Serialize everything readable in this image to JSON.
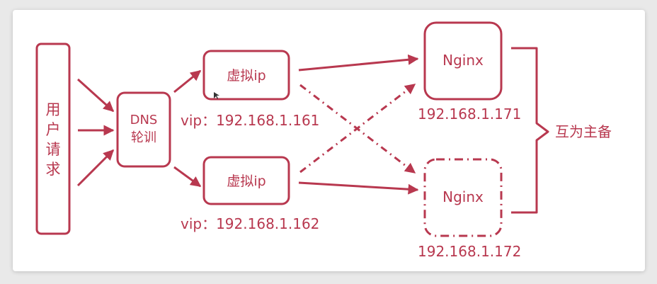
{
  "user_request": {
    "chars": [
      "用",
      "户",
      "请",
      "求"
    ]
  },
  "dns": {
    "line1": "DNS",
    "line2": "轮训"
  },
  "vip_top": {
    "label": "虚拟ip",
    "address": "vip：192.168.1.161"
  },
  "vip_bottom": {
    "label": "虚拟ip",
    "address": "vip：192.168.1.162"
  },
  "nginx_top": {
    "label": "Nginx",
    "address": "192.168.1.171"
  },
  "nginx_bottom": {
    "label": "Nginx",
    "address": "192.168.1.172"
  },
  "relation": {
    "label": "互为主备"
  },
  "colors": {
    "accent": "#b8384f",
    "card": "#ffffff",
    "backdrop": "#e9e9e9"
  }
}
